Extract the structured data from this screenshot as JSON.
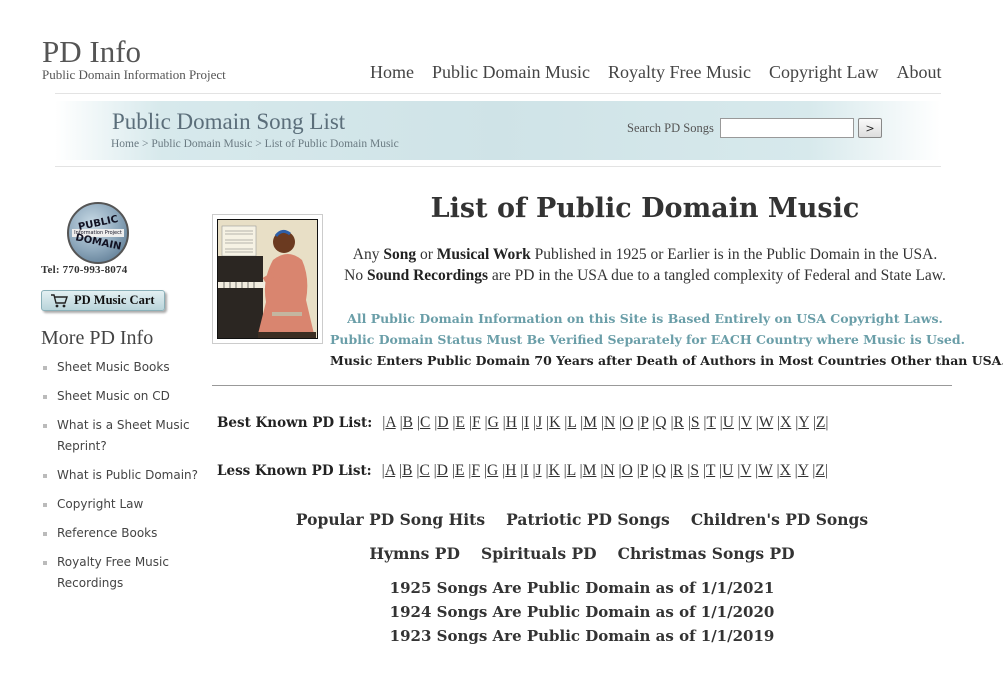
{
  "site": {
    "title": "PD Info",
    "tagline": "Public Domain Information Project"
  },
  "nav": [
    "Home",
    "Public Domain Music",
    "Royalty Free Music",
    "Copyright Law",
    "About"
  ],
  "banner": {
    "title": "Public Domain Song List",
    "breadcrumb": [
      "Home",
      "Public Domain Music",
      "List of Public Domain Music"
    ],
    "search_label": "Search PD Songs",
    "search_value": "",
    "search_button": ">"
  },
  "sidebar": {
    "logo": {
      "line1": "PUBLIC",
      "line2": "Information Project",
      "line3": "DOMAIN"
    },
    "phone": "Tel: 770-993-8074",
    "cart_label": "PD Music Cart",
    "heading": "More PD Info",
    "items": [
      "Sheet Music Books",
      "Sheet Music on CD",
      "What is a Sheet Music Reprint?",
      "What is Public Domain?",
      "Copyright Law",
      "Reference Books",
      "Royalty Free Music Recordings"
    ]
  },
  "main": {
    "title": "List of Public Domain Music",
    "intro1": {
      "a": "Any ",
      "b": "Song",
      "c": " or ",
      "d": "Musical Work",
      "e": " Published in 1925 or Earlier is in the Public Domain in the USA."
    },
    "intro2": {
      "a": "No ",
      "b": "Sound Recordings",
      "c": " are PD in the USA due to a tangled complexity of Federal and State Law."
    },
    "notice1": "All Public Domain Information on this Site is Based Entirely on USA Copyright Laws.",
    "notice2": "Public Domain Status Must Be Verified Separately for EACH Country where Music is Used.",
    "notice3": "Music Enters Public Domain 70 Years after Death of Authors in Most Countries Other than USA.",
    "best_label": "Best Known PD List:",
    "less_label": "Less Known PD List:",
    "letters": [
      "A",
      "B",
      "C",
      "D",
      "E",
      "F",
      "G",
      "H",
      "I",
      "J",
      "K",
      "L",
      "M",
      "N",
      "O",
      "P",
      "Q",
      "R",
      "S",
      "T",
      "U",
      "V",
      "W",
      "X",
      "Y",
      "Z"
    ],
    "links_row1": [
      "Popular PD Song Hits",
      "Patriotic PD Songs",
      "Children's PD Songs"
    ],
    "links_row2": [
      "Hymns PD",
      "Spirituals PD",
      "Christmas Songs PD"
    ],
    "years": [
      "1925 Songs Are Public Domain as of 1/1/2021",
      "1924 Songs Are Public Domain as of 1/1/2020",
      "1923 Songs Are Public Domain as of 1/1/2019"
    ]
  }
}
